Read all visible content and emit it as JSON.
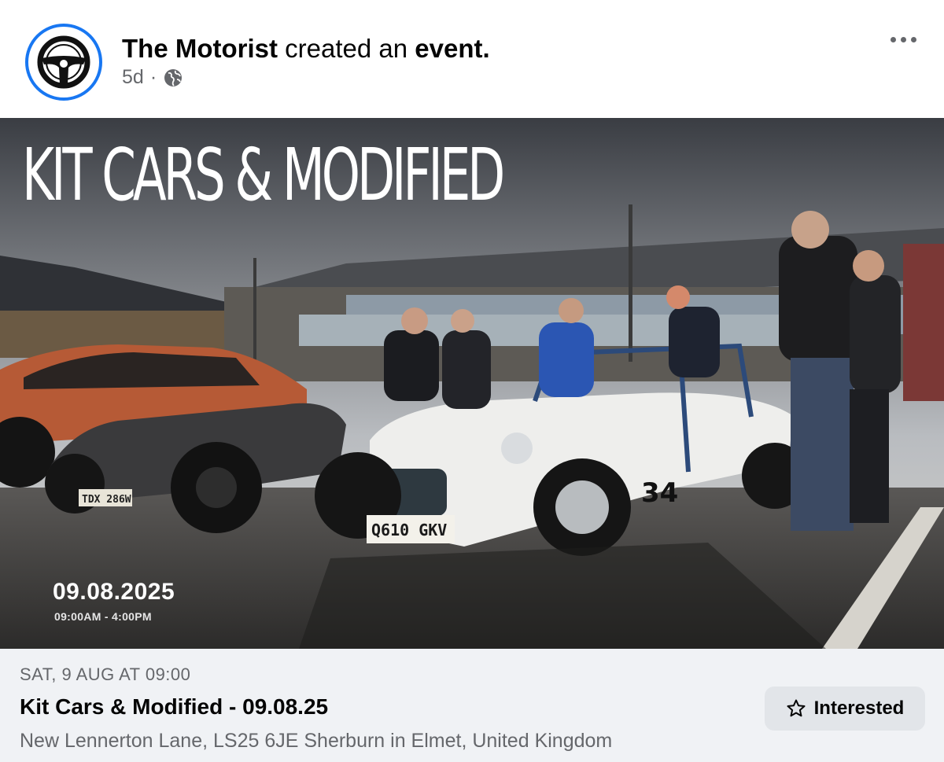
{
  "post": {
    "author": "The Motorist",
    "action_text": "created an",
    "object_text": "event.",
    "time_ago": "5d",
    "separator": "·",
    "audience_icon": "globe-icon",
    "more_icon": "more-horizontal-icon"
  },
  "banner": {
    "title": "KIT CARS & MODIFIED",
    "date": "09.08.2025",
    "hours": "09:00AM - 4:00PM",
    "plates": {
      "left": "TDX 286W",
      "right": "Q610 GKV"
    },
    "race_number": "34"
  },
  "event": {
    "date_line": "SAT, 9 AUG AT 09:00",
    "name": "Kit Cars & Modified - 09.08.25",
    "location": "New Lennerton Lane, LS25 6JE Sherburn in Elmet, United Kingdom",
    "interested_label": "Interested",
    "interested_icon": "star-icon"
  },
  "colors": {
    "accent": "#1877f2",
    "secondary_text": "#65676b",
    "panel_bg": "#f0f2f5",
    "button_bg": "#e2e5e9"
  }
}
